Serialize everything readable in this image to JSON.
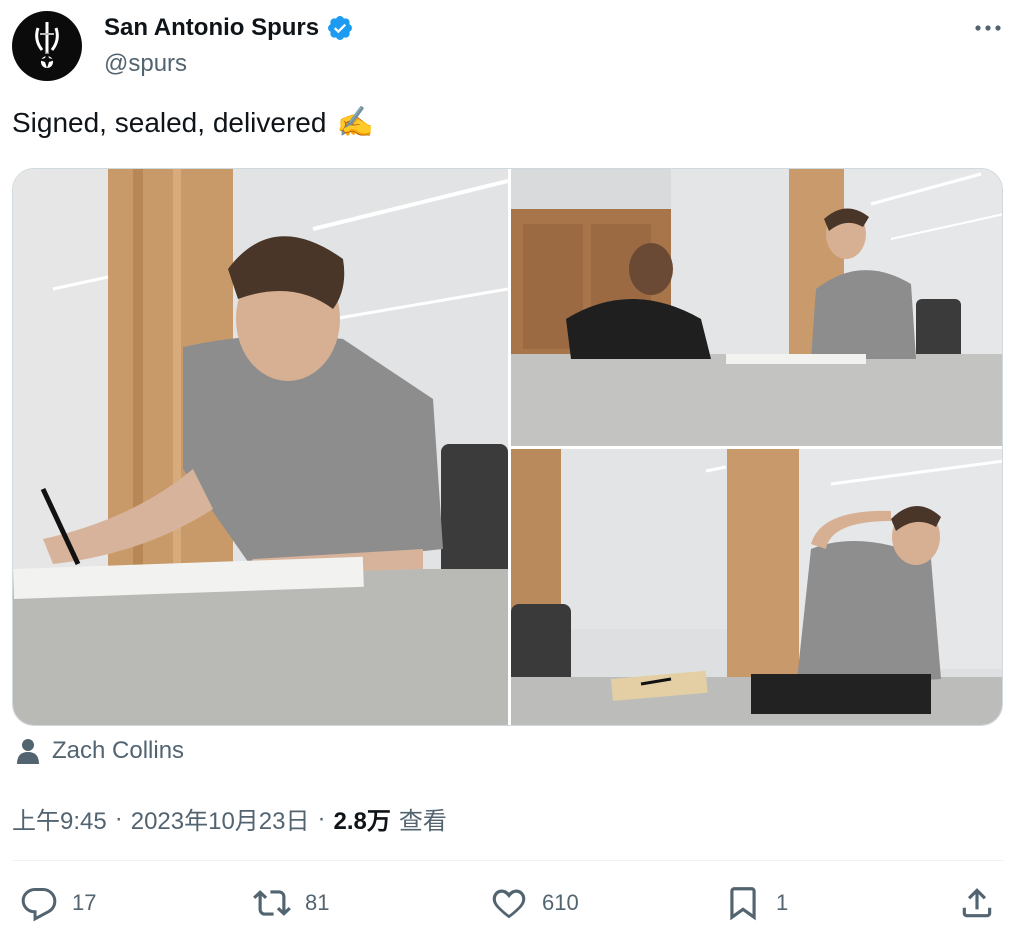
{
  "author": {
    "display_name": "San Antonio Spurs",
    "handle": "@spurs",
    "verified": true,
    "avatar_icon": "spurs-logo-icon"
  },
  "tweet": {
    "text": "Signed, sealed, delivered",
    "emoji": "✍️"
  },
  "media": {
    "photos": [
      {
        "name": "photo-signing-closeup",
        "alt_semantic": "player signing contract"
      },
      {
        "name": "photo-signing-with-official",
        "alt_semantic": "player signing across table"
      },
      {
        "name": "photo-celebrating",
        "alt_semantic": "player smiling after signing"
      }
    ],
    "tagged_person": "Zach Collins"
  },
  "meta": {
    "time": "上午9:45",
    "separator": "·",
    "date": "2023年10月23日",
    "views_count": "2.8万",
    "views_label": "查看"
  },
  "actions": {
    "reply_count": "17",
    "retweet_count": "81",
    "like_count": "610",
    "bookmark_count": "1"
  },
  "colors": {
    "text_primary": "#0f1419",
    "text_secondary": "#536471",
    "verified_blue": "#1d9bf0",
    "divider": "#eff3f4"
  }
}
